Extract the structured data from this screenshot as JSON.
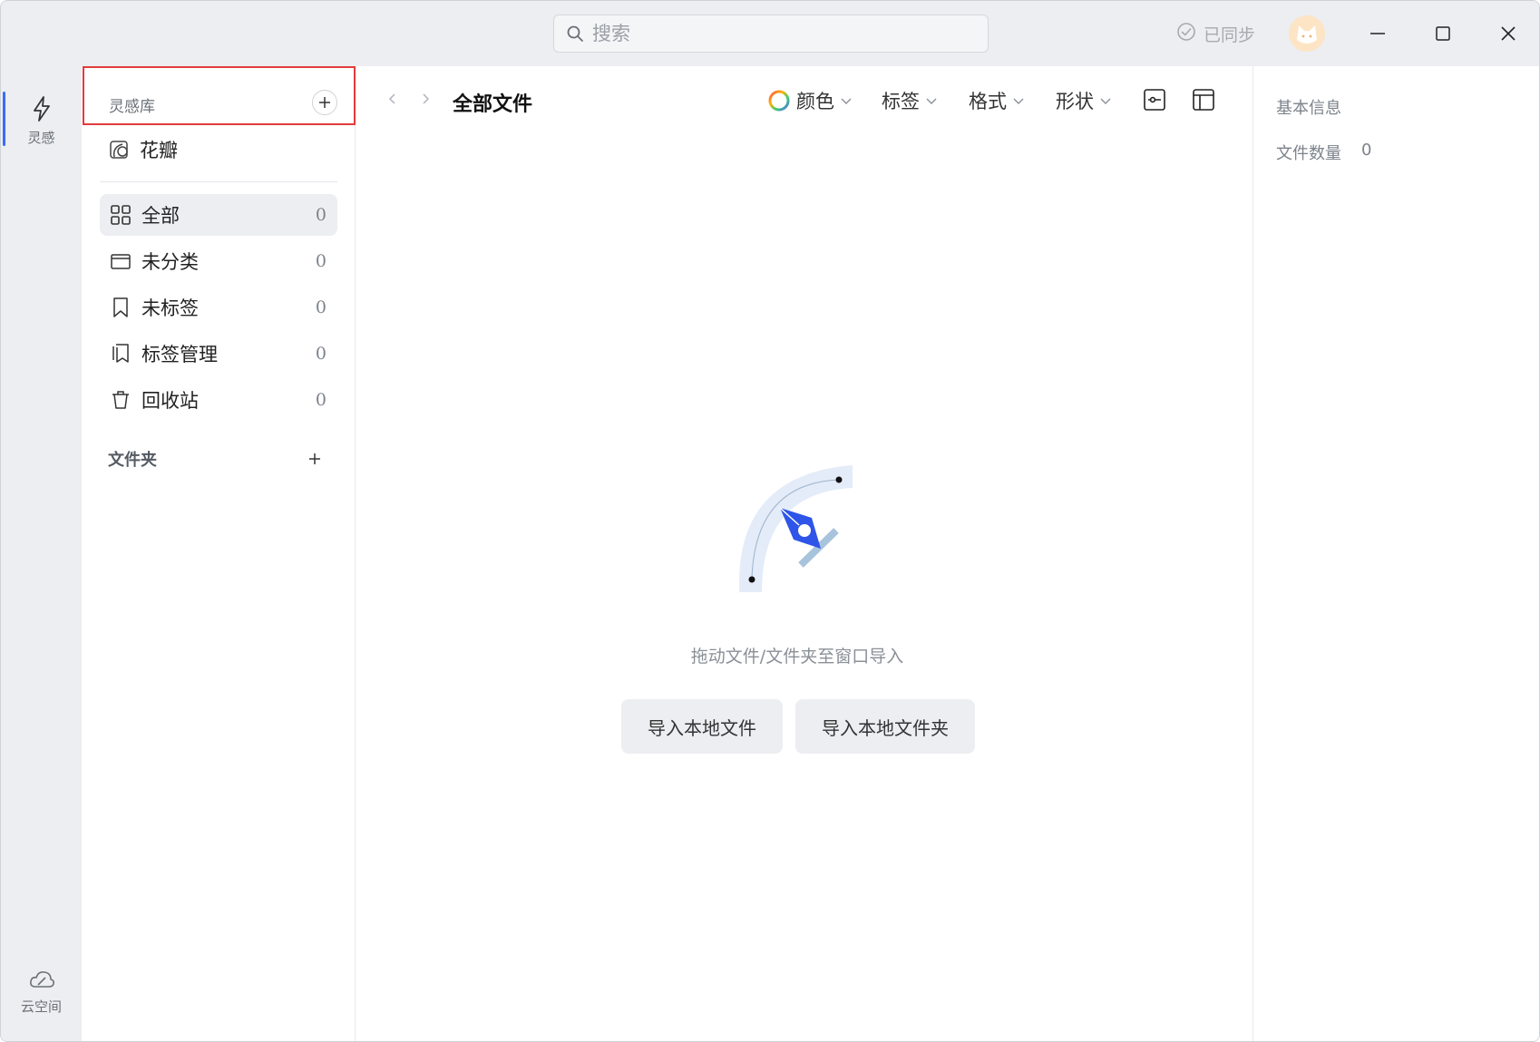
{
  "titlebar": {
    "search_placeholder": "搜索",
    "sync_status": "已同步"
  },
  "rail": {
    "items": [
      {
        "label": "灵感",
        "icon": "lightning-icon",
        "active": true
      },
      {
        "label": "云空间",
        "icon": "cloud-icon",
        "active": false
      }
    ]
  },
  "sidebar": {
    "library_title": "灵感库",
    "library_item": "花瓣",
    "nav": [
      {
        "label": "全部",
        "count": "0",
        "icon": "grid-icon"
      },
      {
        "label": "未分类",
        "count": "0",
        "icon": "tray-icon"
      },
      {
        "label": "未标签",
        "count": "0",
        "icon": "bookmark-icon"
      },
      {
        "label": "标签管理",
        "count": "0",
        "icon": "tag-manage-icon"
      },
      {
        "label": "回收站",
        "count": "0",
        "icon": "trash-icon"
      }
    ],
    "folder_title": "文件夹"
  },
  "main": {
    "title": "全部文件",
    "filters": [
      {
        "label": "颜色"
      },
      {
        "label": "标签"
      },
      {
        "label": "格式"
      },
      {
        "label": "形状"
      }
    ],
    "empty_text": "拖动文件/文件夹至窗口导入",
    "import_file_label": "导入本地文件",
    "import_folder_label": "导入本地文件夹"
  },
  "info": {
    "title": "基本信息",
    "file_count_label": "文件数量",
    "file_count_value": "0"
  },
  "colors": {
    "accent": "#3b6cf6",
    "highlight_border": "#e23b3b",
    "chrome_bg": "#eceef1"
  }
}
